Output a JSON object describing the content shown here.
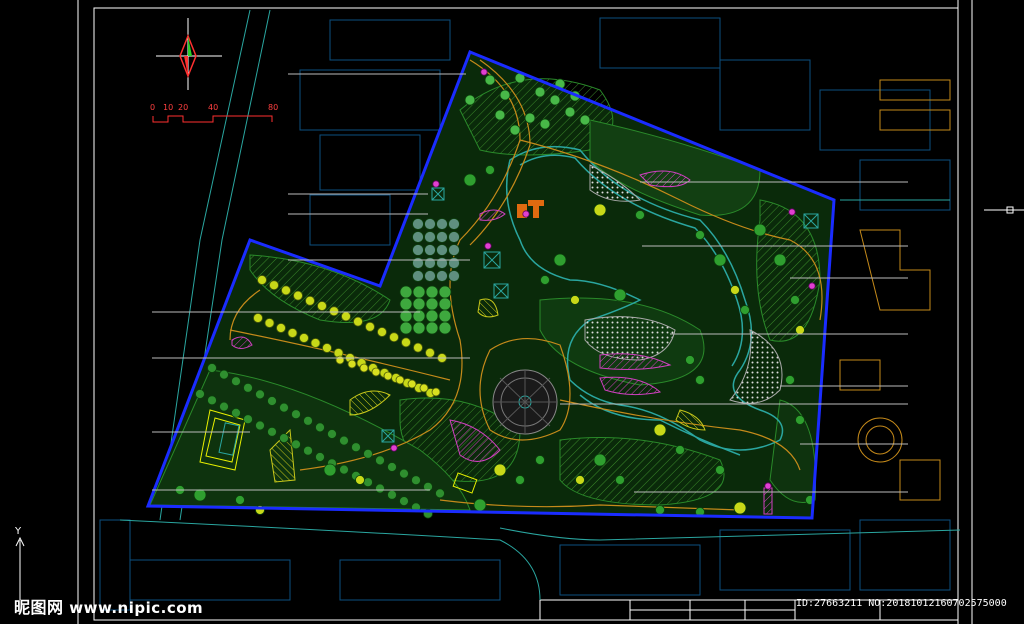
{
  "scale_bar": {
    "labels": [
      "0",
      "10",
      "20",
      "40",
      "80"
    ]
  },
  "axis_label": "Y",
  "watermark": {
    "brand": "昵图网",
    "url": "www.nipic.com"
  },
  "image_id": "ID:27663211 NO:20181012160702575000",
  "colors": {
    "boundary": "#1a2cff",
    "vegetation": "#1f7a1f",
    "paths": "#c58a1a",
    "water": "#2aa6a0",
    "buildings": "#0a4a7a",
    "accent_magenta": "#d040c0",
    "accent_yellow": "#e8f000",
    "pavilion": "#e06a10"
  }
}
